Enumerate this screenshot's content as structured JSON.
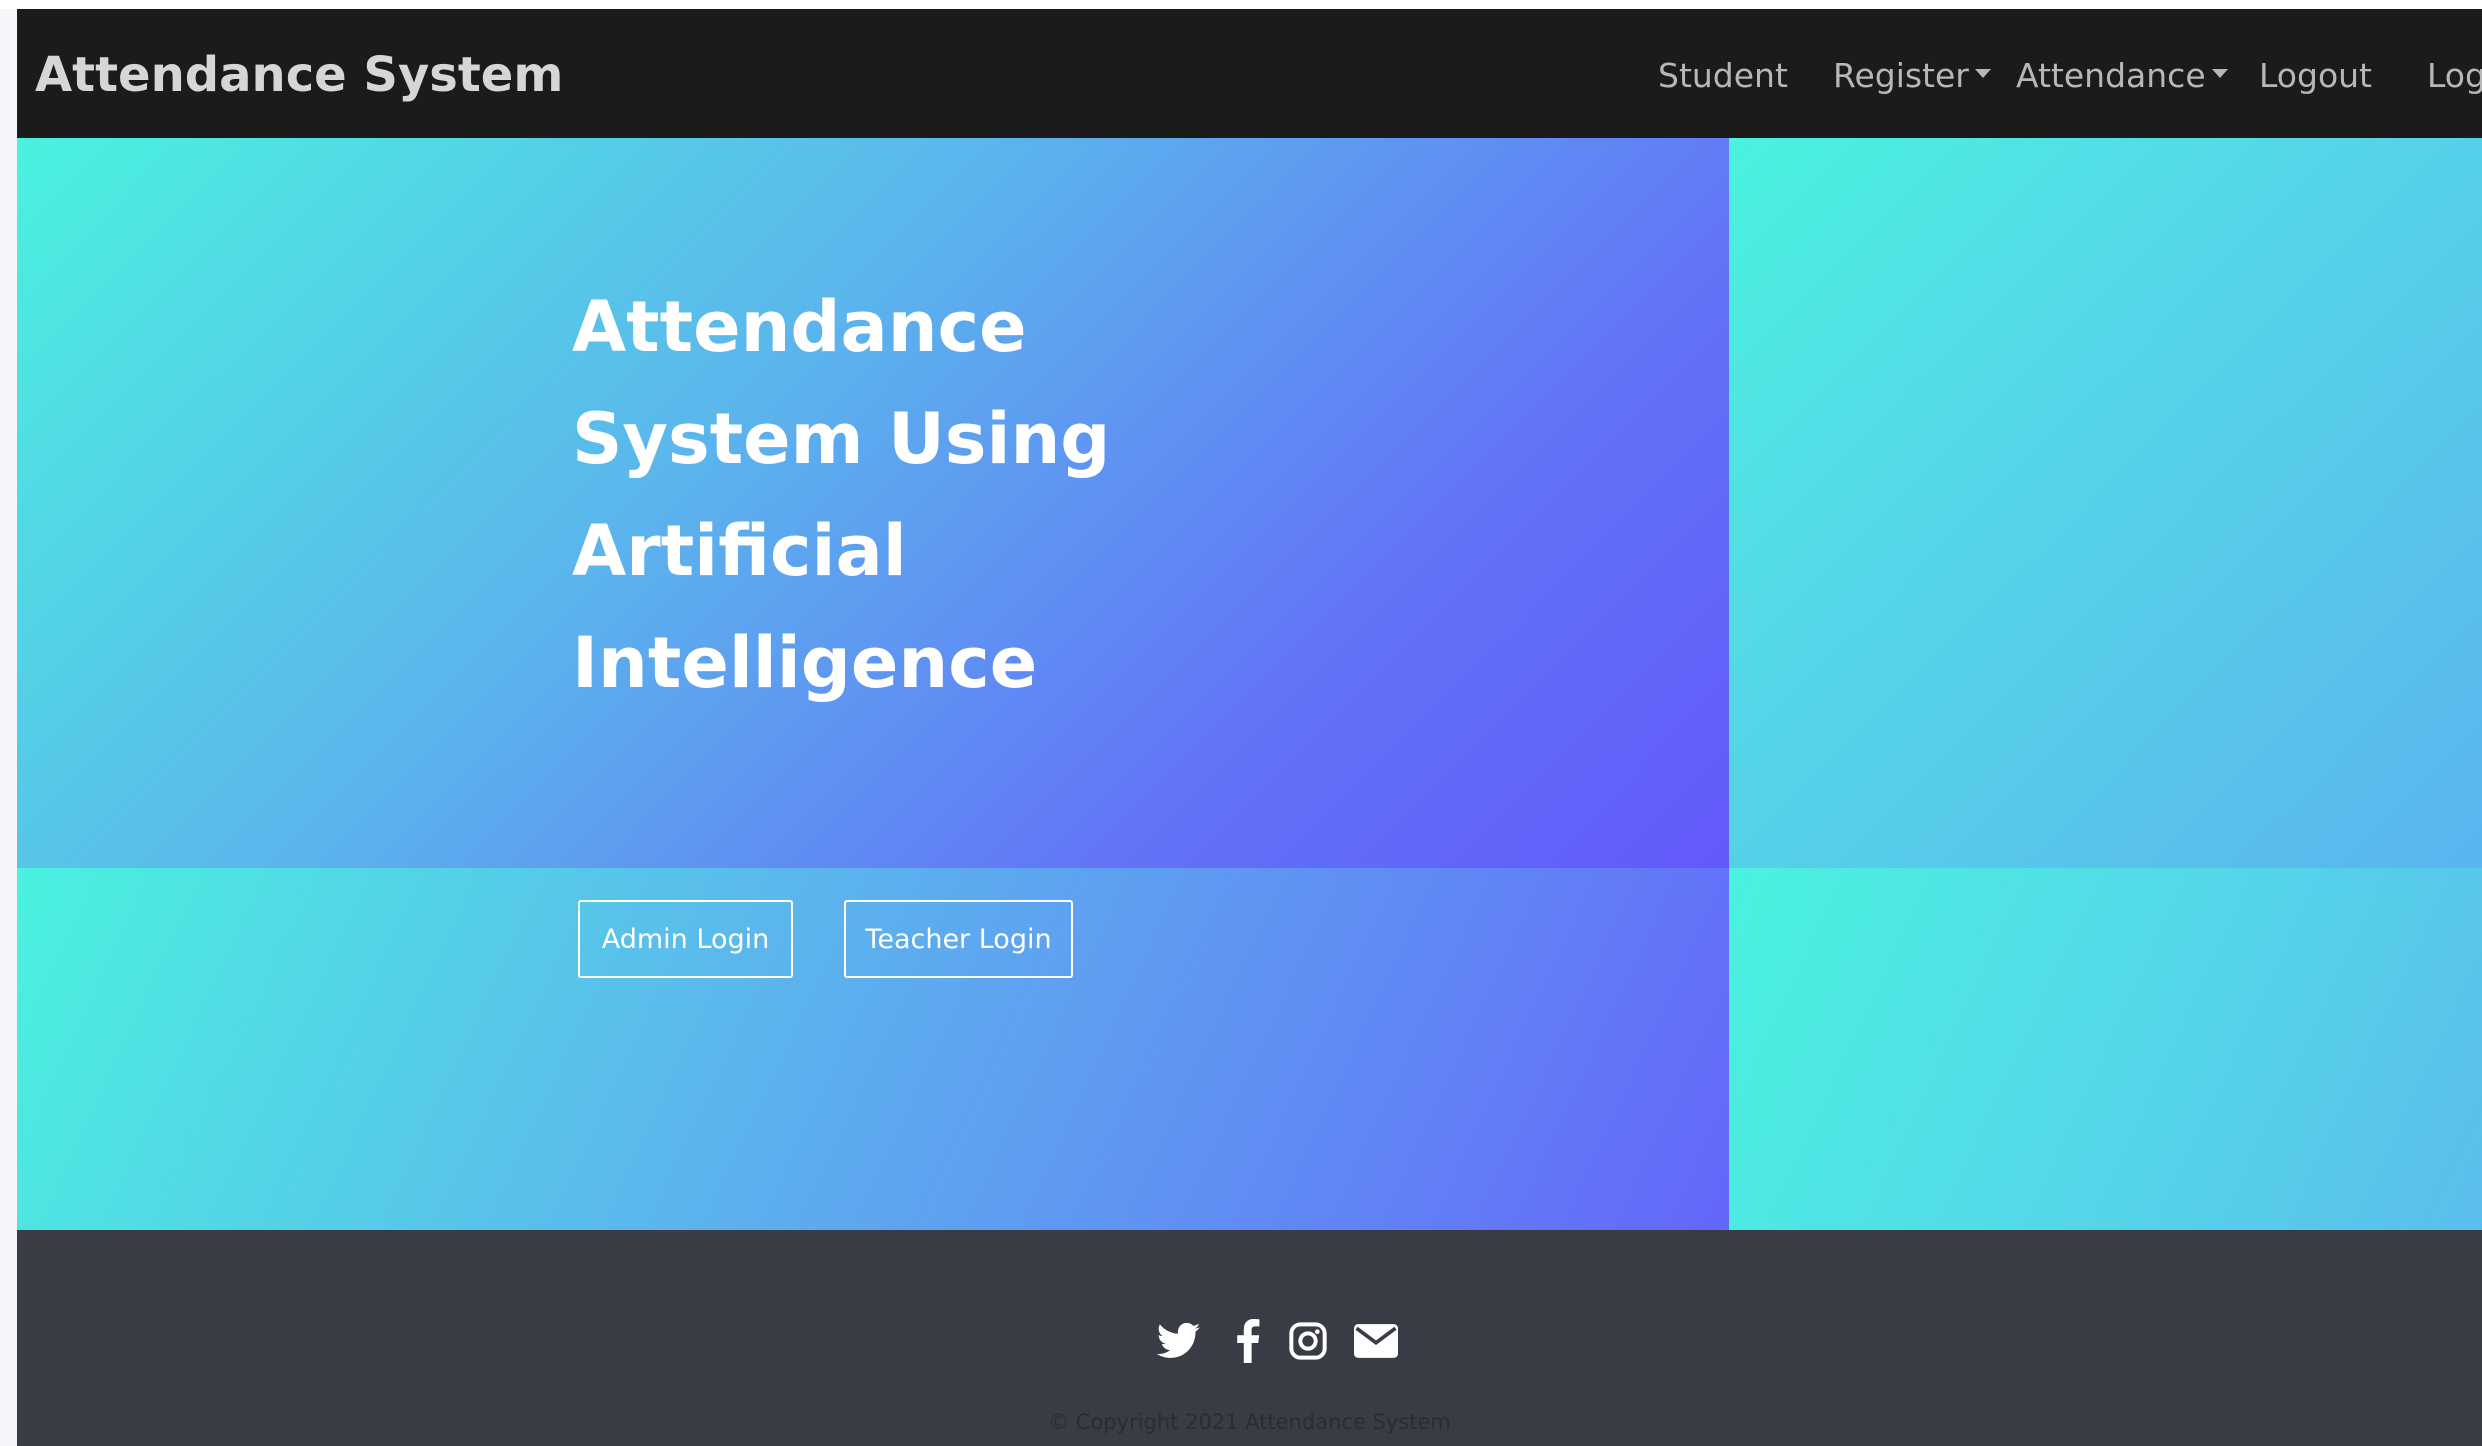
{
  "navbar": {
    "brand": "Attendance System",
    "items": [
      {
        "label": "Student",
        "dropdown": false
      },
      {
        "label": "Register",
        "dropdown": true
      },
      {
        "label": "Attendance",
        "dropdown": true
      },
      {
        "label": "Logout",
        "dropdown": false
      },
      {
        "label": "Log",
        "dropdown": false
      }
    ]
  },
  "hero": {
    "title_lines": [
      "Attendance",
      "System Using",
      "Artificial",
      "Intelligence"
    ],
    "buttons": {
      "admin_login": "Admin Login",
      "teacher_login": "Teacher Login"
    }
  },
  "footer": {
    "social_icons": [
      "twitter-icon",
      "facebook-icon",
      "instagram-icon",
      "email-icon"
    ],
    "copyright": "© Copyright 2021 Attendance System"
  },
  "colors": {
    "navbar_bg": "#1b1b1b",
    "footer_bg": "#393c45",
    "gradient_start": "#4af2df",
    "gradient_end": "#6359fb"
  }
}
